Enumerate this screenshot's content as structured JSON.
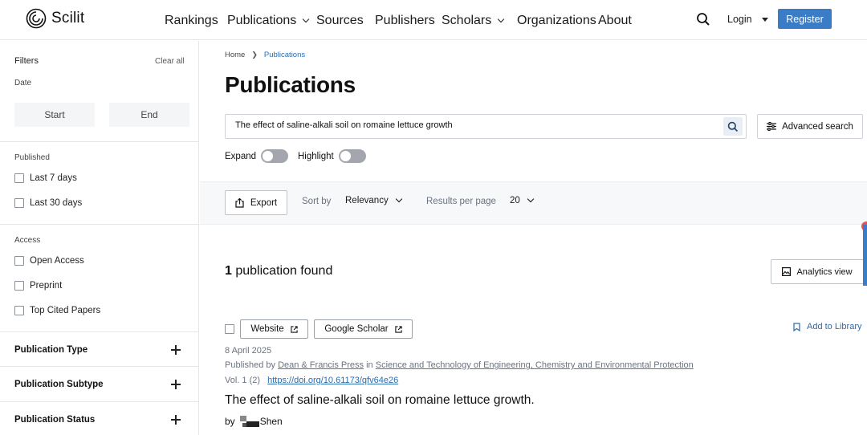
{
  "header": {
    "brand": "Scilit",
    "nav": [
      "Rankings",
      "Publications",
      "Sources",
      "Publishers",
      "Scholars",
      "Organizations",
      "About"
    ],
    "login": "Login",
    "register": "Register"
  },
  "sidebar": {
    "filters_title": "Filters",
    "clear_all": "Clear all",
    "date_label": "Date",
    "date_start": "Start",
    "date_end": "End",
    "published_label": "Published",
    "published_options": [
      "Last 7 days",
      "Last 30 days"
    ],
    "access_label": "Access",
    "access_options": [
      "Open Access",
      "Preprint",
      "Top Cited Papers"
    ],
    "sections": [
      "Publication Type",
      "Publication Subtype",
      "Publication Status"
    ]
  },
  "main": {
    "breadcrumb": [
      "Home",
      "Publications"
    ],
    "title": "Publications",
    "search_value": "The effect of saline-alkali soil on romaine lettuce growth",
    "advanced_search": "Advanced search",
    "expand_label": "Expand",
    "highlight_label": "Highlight",
    "export_label": "Export",
    "sort_by_label": "Sort by",
    "sort_by_value": "Relevancy",
    "results_per_page_label": "Results per page",
    "results_per_page_value": "20",
    "found_count": "1",
    "found_text": "publication found",
    "analytics_view": "Analytics view"
  },
  "result": {
    "website_btn": "Website",
    "scholar_btn": "Google Scholar",
    "add_to_library": "Add to Library",
    "date": "8 April 2025",
    "published_by_prefix": "Published by",
    "publisher": "Dean & Francis Press",
    "in_text": "in",
    "journal": "Science and Technology of Engineering, Chemistry and Environmental Protection",
    "volume": "Vol. 1",
    "issue": "(2)",
    "doi": "https://doi.org/10.61173/qfv64e26",
    "title": "The effect of saline-alkali soil on romaine lettuce growth.",
    "by_prefix": "by",
    "author_visible": "Shen"
  },
  "colors": {
    "accent": "#3a7cc5",
    "link": "#2b6cb0",
    "toggle_off": "#a3a7ad"
  }
}
